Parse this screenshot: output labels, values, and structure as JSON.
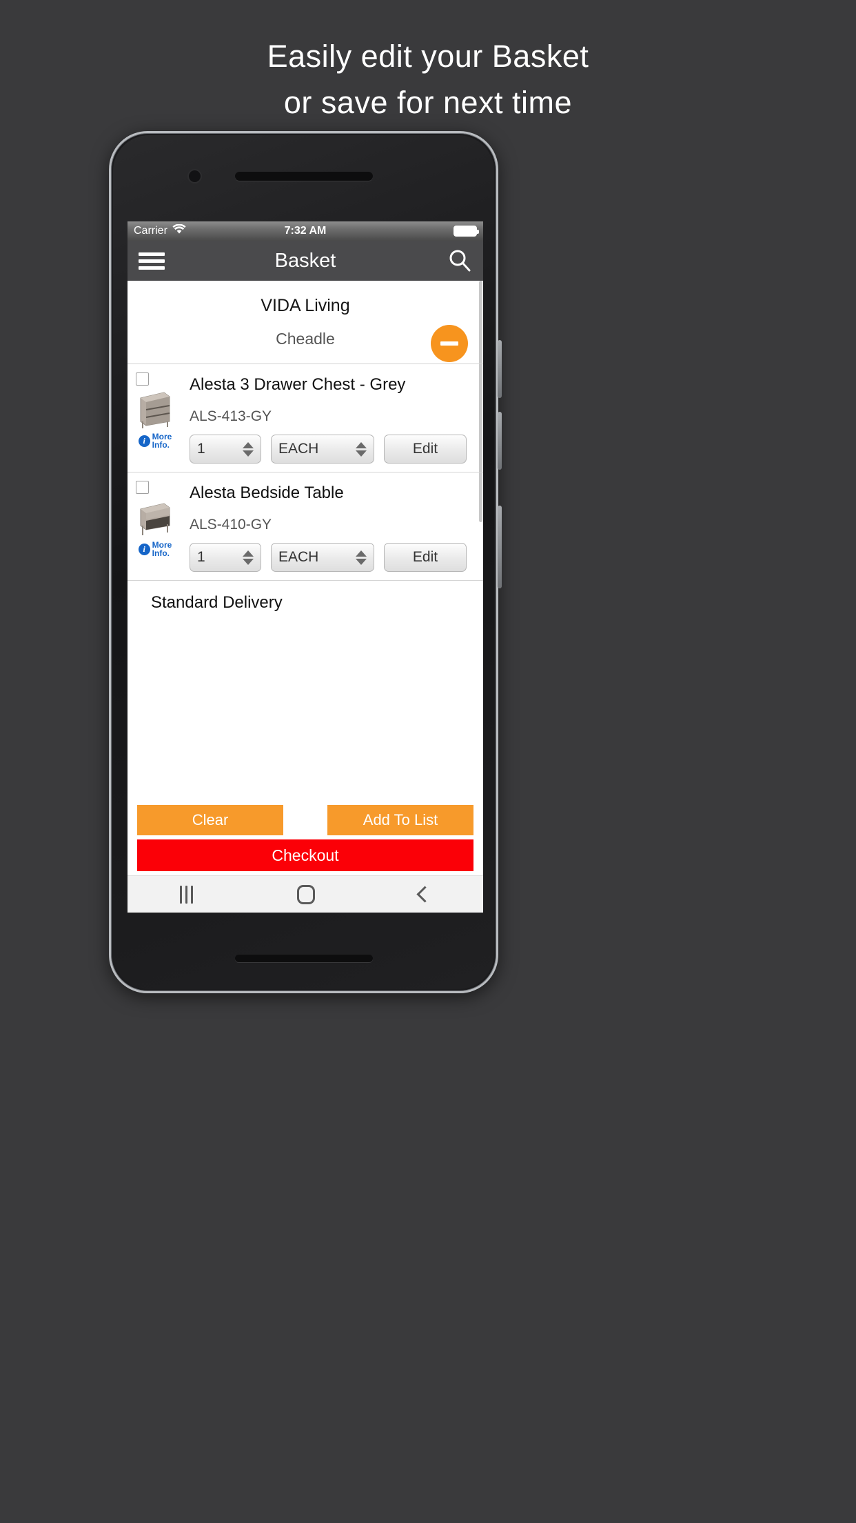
{
  "promo": {
    "headline_line1": "Easily edit your Basket",
    "headline_line2": "or save for next time",
    "background_color": "#3a3a3c",
    "text_color": "#ffffff"
  },
  "status_bar": {
    "carrier": "Carrier",
    "wifi_icon": "wifi-icon",
    "time": "7:32 AM",
    "battery_icon": "battery-full-icon"
  },
  "app_bar": {
    "menu_icon": "hamburger-menu-icon",
    "title": "Basket",
    "search_icon": "search-icon",
    "background_color": "#4a4a4c"
  },
  "supplier": {
    "name": "VIDA Living",
    "branch": "Cheadle",
    "collapse_icon": "minus-icon",
    "collapse_color": "#f7941e"
  },
  "items": [
    {
      "checkbox_checked": false,
      "thumbnail": "chest-of-drawers-thumbnail",
      "more_info_icon": "info-icon",
      "more_info_label_line1": "More",
      "more_info_label_line2": "Info.",
      "title": "Alesta 3 Drawer Chest - Grey",
      "sku": "ALS-413-GY",
      "quantity": "1",
      "uom": "EACH",
      "edit_label": "Edit"
    },
    {
      "checkbox_checked": false,
      "thumbnail": "bedside-table-thumbnail",
      "more_info_icon": "info-icon",
      "more_info_label_line1": "More",
      "more_info_label_line2": "Info.",
      "title": "Alesta Bedside Table",
      "sku": "ALS-410-GY",
      "quantity": "1",
      "uom": "EACH",
      "edit_label": "Edit"
    }
  ],
  "delivery": {
    "label": "Standard Delivery"
  },
  "footer": {
    "clear_label": "Clear",
    "add_to_list_label": "Add To List",
    "checkout_label": "Checkout",
    "orange": "#f79a2b",
    "red": "#fb0007"
  },
  "nav_bar": {
    "recents_icon": "recents-icon",
    "home_icon": "home-icon",
    "back_icon": "back-icon"
  }
}
